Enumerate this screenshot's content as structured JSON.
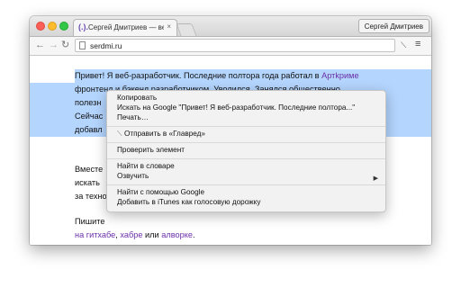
{
  "tab": {
    "title": "Сергей Дмитриев — веб",
    "favicon": "(.).",
    "close": "×"
  },
  "profile": {
    "name": "Сергей Дмитриев"
  },
  "nav": {
    "back": "←",
    "forward": "→",
    "reload": "↻"
  },
  "omnibox": {
    "url": "serdmi.ru"
  },
  "toolbar": {
    "extension_icon": "⟍",
    "menu_icon": "≡"
  },
  "content": {
    "p1_line1_a": "Привет! Я веб-разработчик. Последние полтора года работал в ",
    "p1_link": "Артkриме",
    "p1_line2": "фронтенд и бэкенд разработчиком. Уволился. Занялся общественно",
    "p1_line3": "полезн",
    "p1_line4": "Сейчас",
    "p1_line5": "добавл",
    "p2_line1": "Вместе",
    "p2_line2": "искать",
    "p2_line3": "за техно",
    "p3_line1": "Пишите",
    "p3_link1": "на гитхабе",
    "p3_sep": ", ",
    "p3_link2": "хабре",
    "p3_or": " или ",
    "p3_link3": "алворке",
    "p3_end": "."
  },
  "context_menu": {
    "copy": "Копировать",
    "search_google": "Искать на Google \"Привет! Я веб-разработчик. Последние полтора...\"",
    "print": "Печать…",
    "send_glavred": "Отправить в «Главред»",
    "inspect": "Проверить элемент",
    "dictionary": "Найти в словаре",
    "speak": "Озвучить",
    "speak_arrow": "▶",
    "google_find": "Найти с помощью Google",
    "itunes": "Добавить в iTunes как голосовую дорожку"
  }
}
